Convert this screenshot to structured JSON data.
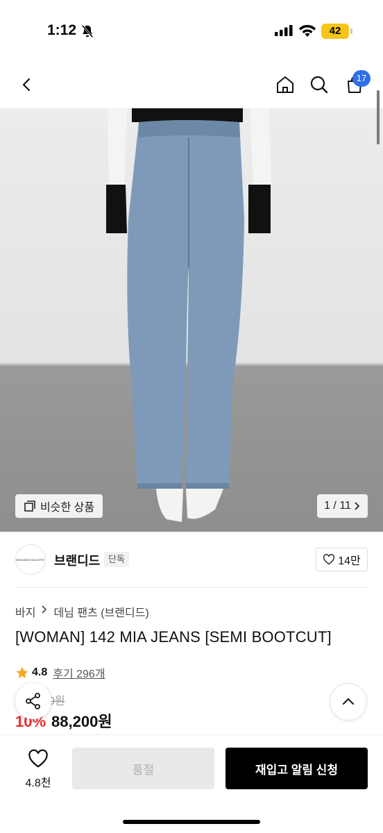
{
  "status_bar": {
    "time": "1:12",
    "battery": "42"
  },
  "header": {
    "cart_count": "17"
  },
  "hero": {
    "similar_label": "비슷한 상품",
    "page_indicator": "1 / 11"
  },
  "brand": {
    "logo_text": "BRANDED INDUSTRY",
    "name": "브랜디드",
    "tag": "단독",
    "likes": "14만"
  },
  "breadcrumb": {
    "category": "바지",
    "subcategory": "데님 팬츠 (브랜디드)"
  },
  "product": {
    "title": "[WOMAN] 142 MIA JEANS [SEMI BOOTCUT]",
    "rating": "4.8",
    "reviews": "후기 296개",
    "original_price": "0원",
    "discount": "10%",
    "sale_price": "88,200원"
  },
  "bottom_bar": {
    "wish_count": "4.8천",
    "soldout_label": "품절",
    "restock_label": "재입고 알림 신청"
  },
  "colors": {
    "accent_blue": "#2f6fea",
    "discount_red": "#ef2b2b",
    "star": "#f5a623"
  }
}
